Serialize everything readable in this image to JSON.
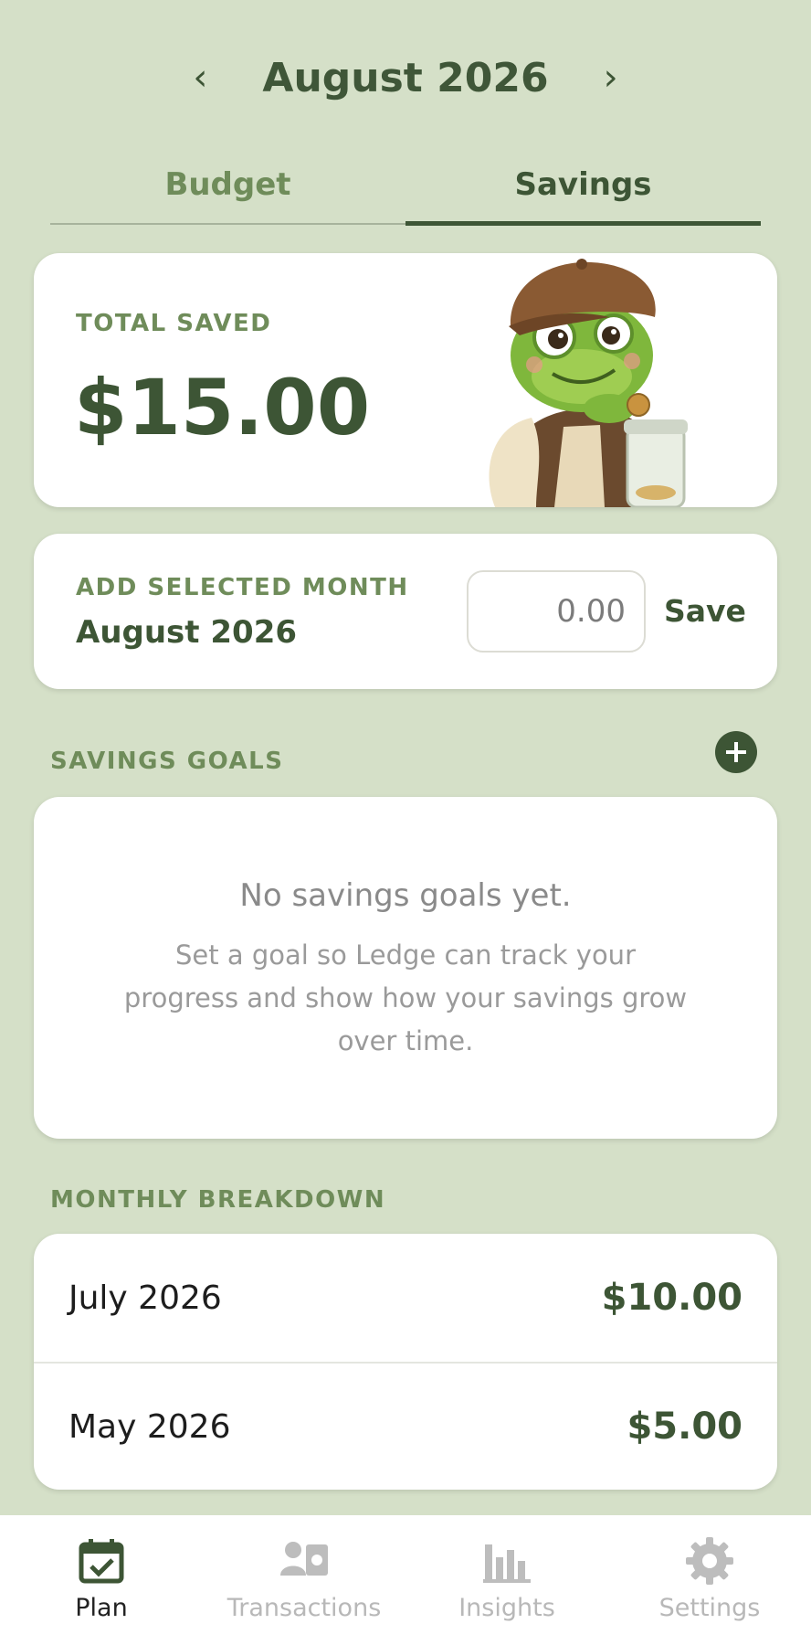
{
  "header": {
    "month_title": "August 2026",
    "prev_icon": "chevron-left-icon",
    "next_icon": "chevron-right-icon"
  },
  "tabs": [
    {
      "label": "Budget",
      "active": false
    },
    {
      "label": "Savings",
      "active": true
    }
  ],
  "total_saved": {
    "label": "TOTAL SAVED",
    "amount": "$15.00",
    "illustration": "frog-mascot-with-coin-jar"
  },
  "add_month": {
    "label": "ADD SELECTED MONTH",
    "month": "August 2026",
    "input_placeholder": "0.00",
    "input_value": "",
    "save_label": "Save"
  },
  "savings_goals": {
    "label": "SAVINGS GOALS",
    "add_icon": "plus-icon",
    "empty_title": "No savings goals yet.",
    "empty_body": "Set a goal so Ledge can track your progress and show how your savings grow over time."
  },
  "monthly_breakdown": {
    "label": "MONTHLY BREAKDOWN",
    "rows": [
      {
        "month": "July 2026",
        "amount": "$10.00"
      },
      {
        "month": "May 2026",
        "amount": "$5.00"
      }
    ]
  },
  "bottom_nav": [
    {
      "label": "Plan",
      "icon": "calendar-check-icon",
      "active": true
    },
    {
      "label": "Transactions",
      "icon": "person-cash-icon",
      "active": false
    },
    {
      "label": "Insights",
      "icon": "bar-chart-icon",
      "active": false
    },
    {
      "label": "Settings",
      "icon": "gear-icon",
      "active": false
    }
  ],
  "colors": {
    "background": "#d5e0c8",
    "accent": "#3d5535",
    "label_green": "#6f8c5a"
  }
}
